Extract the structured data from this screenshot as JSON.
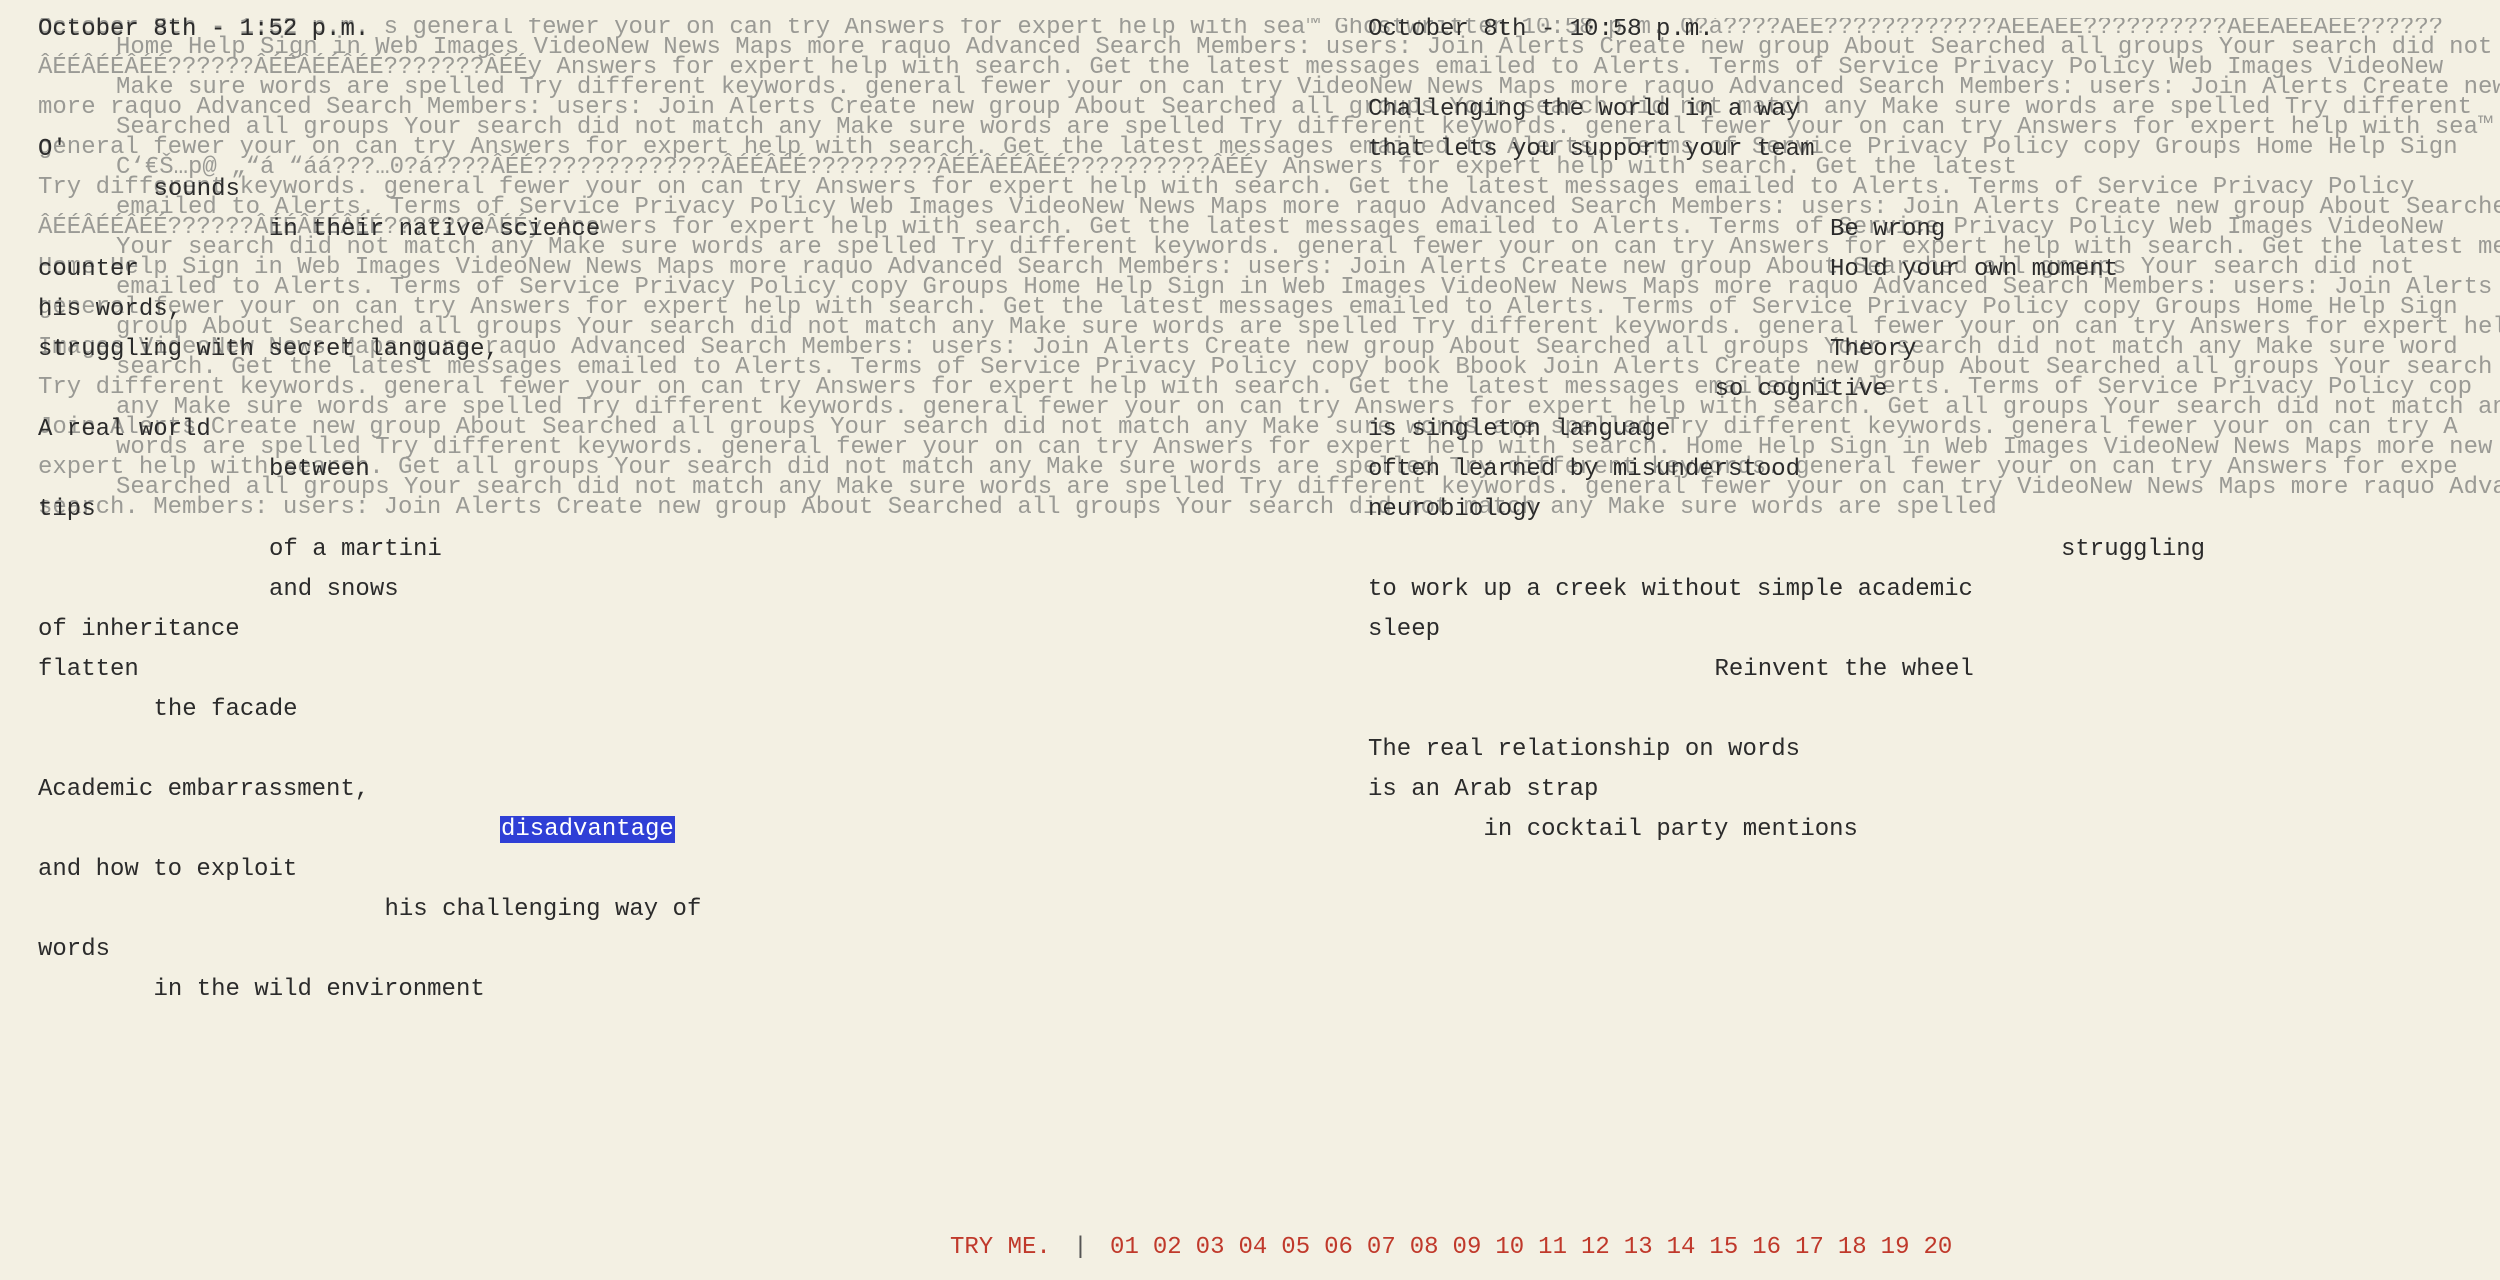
{
  "background_noise": [
    "October 8th - 1:52 p.m. s general fewer your on can try Answers for expert help with sea™ Ghostwritten 10:58 p.m. 0?á????ÂÉÉ????????????ÂÉÉÂÉÉ??????????ÂÉÉÂÉÉÂÉÉ??????",
    "Home Help Sign in Web Images VideoNew News Maps more raquo Advanced Search Members: users: Join Alerts Create new group About Searched all groups Your search did not",
    "ÂÉÉÂÉÉÂÉÉ??????ÂÉÉÂÉÉÂÉÉ???????ÂÉÉy Answers for expert help with search. Get the latest messages emailed to Alerts. Terms of Service Privacy Policy Web Images VideoNew",
    "Make sure words are spelled Try different keywords. general fewer your on can try VideoNew News Maps more raquo Advanced Search Members: users: Join Alerts Create new",
    "more raquo Advanced Search Members: users: Join Alerts Create new group About Searched all groups Your search did not match any Make sure words are spelled Try different",
    "Searched all groups Your search did not match any Make sure words are spelled Try different keywords. general fewer your on can try Answers for expert help with sea™",
    "general fewer your on can try Answers for expert help with search. Get the latest messages emailed to Alerts. Terms of Service Privacy Policy copy Groups Home Help Sign",
    "C‘€Š…p@ „“á  “áá???…0?á????ÂÉÉ?????????????ÂÉÉÂÉÉ?????????ÂÉÉÂÉÉÂÉÉ??????????ÂÉÉy Answers for expert help with search. Get the latest",
    "Try different keywords. general fewer your on can try Answers for expert help with search. Get the latest messages emailed to Alerts. Terms of Service Privacy Policy",
    "emailed to Alerts. Terms of Service Privacy Policy Web Images VideoNew News Maps more raquo Advanced Search Members: users: Join Alerts Create new group About Searched",
    "ÂÉÉÂÉÉÂÉÉ??????ÂÉÉÂÉÉÂÉÉ???????ÂÉÉy Answers for expert help with search. Get the latest messages emailed to Alerts. Terms of Service Privacy Policy Web Images VideoNew",
    "Your search did not match any Make sure words are spelled Try different keywords. general fewer your on can try Answers for expert help with search. Get the latest me",
    "Home Help Sign in Web Images VideoNew News Maps more raquo Advanced Search Members: users: Join Alerts Create new group About Searched all groups Your search did not",
    "emailed to Alerts. Terms of Service Privacy Policy copy Groups Home Help Sign in Web Images VideoNew News Maps more raquo Advanced Search Members: users: Join Alerts",
    "general fewer your on can try Answers for expert help with search. Get the latest messages emailed to Alerts. Terms of Service Privacy Policy copy Groups Home Help Sign",
    "group About Searched all groups Your search did not match any Make sure words are spelled Try different keywords. general fewer your on can try Answers for expert help",
    "Images VideoNew News Maps more raquo Advanced Search Members: users: Join Alerts Create new group About Searched all groups Your search did not match any Make sure word",
    "search. Get the latest messages emailed to Alerts. Terms of Service Privacy Policy copy book Bbook Join Alerts Create new group About Searched all groups Your search",
    "Try different keywords. general fewer your on can try Answers for expert help with search. Get the latest messages emailed to Alerts. Terms of Service Privacy Policy cop",
    "any Make sure words are spelled Try different keywords. general fewer your on can try Answers for expert help with search. Get all groups Your search did not match an",
    "Join Alerts Create new group About Searched all groups Your search did not match any Make sure words are spelled Try different keywords. general fewer your on can try A",
    "words are spelled Try different keywords. general fewer your on can try Answers for expert help with search. Home Help Sign in Web Images VideoNew News Maps more new",
    "expert help with search. Get all groups Your search did not match any Make sure words are spelled Try different keywords. general fewer your on can try Answers for expe",
    "Searched all groups Your search did not match any Make sure words are spelled Try different keywords. general fewer your on can try VideoNew News Maps more raquo Adva",
    "search. Members: users: Join Alerts Create new group About Searched all groups Your search did not match any Make sure words are spelled"
  ],
  "left_column": [
    {
      "text": "October 8th - 1:52 p.m.",
      "x": 0,
      "y": 0
    },
    {
      "text": "O'",
      "x": 0,
      "y": 3
    },
    {
      "text": "sounds",
      "x": 3,
      "y": 4
    },
    {
      "text": "in their native science",
      "x": 6,
      "y": 5
    },
    {
      "text": "counter",
      "x": 0,
      "y": 6
    },
    {
      "text": "his words,",
      "x": 0,
      "y": 7
    },
    {
      "text": "struggling with secret language,",
      "x": 0,
      "y": 8
    },
    {
      "text": "A real world",
      "x": 0,
      "y": 10
    },
    {
      "text": "between",
      "x": 6,
      "y": 11
    },
    {
      "text": "tips",
      "x": 0,
      "y": 12
    },
    {
      "text": "of a martini",
      "x": 6,
      "y": 13
    },
    {
      "text": "and snows",
      "x": 6,
      "y": 14
    },
    {
      "text": "of inheritance",
      "x": 0,
      "y": 15
    },
    {
      "text": "flatten",
      "x": 0,
      "y": 16
    },
    {
      "text": "the facade",
      "x": 3,
      "y": 17
    },
    {
      "text": "Academic embarrassment,",
      "x": 0,
      "y": 19
    },
    {
      "text": "disadvantage",
      "x": 12,
      "y": 20,
      "highlight": true
    },
    {
      "text": "and how to exploit",
      "x": 0,
      "y": 21
    },
    {
      "text": "his challenging way of",
      "x": 9,
      "y": 22
    },
    {
      "text": "words",
      "x": 0,
      "y": 23
    },
    {
      "text": "in the wild environment",
      "x": 3,
      "y": 24
    }
  ],
  "right_column": [
    {
      "text": "October 8th - 10:58 p.m.",
      "x": 0,
      "y": 0
    },
    {
      "text": "Challenging the world in a way",
      "x": 0,
      "y": 2
    },
    {
      "text": "that lets you support your team",
      "x": 0,
      "y": 3
    },
    {
      "text": "Be wrong",
      "x": 12,
      "y": 5
    },
    {
      "text": "Hold your own moment",
      "x": 12,
      "y": 6
    },
    {
      "text": "Theory",
      "x": 12,
      "y": 8
    },
    {
      "text": "so cognitive",
      "x": 9,
      "y": 9
    },
    {
      "text": "is singleton language",
      "x": 0,
      "y": 10
    },
    {
      "text": "often learned by misunderstood",
      "x": 0,
      "y": 11
    },
    {
      "text": "neurobiology",
      "x": 0,
      "y": 12
    },
    {
      "text": "struggling",
      "x": 18,
      "y": 13
    },
    {
      "text": "to work up a creek without simple academic",
      "x": 0,
      "y": 14
    },
    {
      "text": "sleep",
      "x": 0,
      "y": 15
    },
    {
      "text": "Reinvent the wheel",
      "x": 9,
      "y": 16
    },
    {
      "text": "The real relationship on words",
      "x": 0,
      "y": 18
    },
    {
      "text": "is an Arab strap",
      "x": 0,
      "y": 19
    },
    {
      "text": "in cocktail party mentions",
      "x": 3,
      "y": 20
    }
  ],
  "pager": {
    "try_label": "TRY ME.",
    "separator": "|",
    "pages": [
      "01",
      "02",
      "03",
      "04",
      "05",
      "06",
      "07",
      "08",
      "09",
      "10",
      "11",
      "12",
      "13",
      "14",
      "15",
      "16",
      "17",
      "18",
      "19",
      "20"
    ]
  },
  "colors": {
    "background": "#f3f0e3",
    "text": "#2b2b2b",
    "noise": "#9a9a95",
    "highlight_bg": "#2f3fd6",
    "pager": "#c0392b"
  }
}
